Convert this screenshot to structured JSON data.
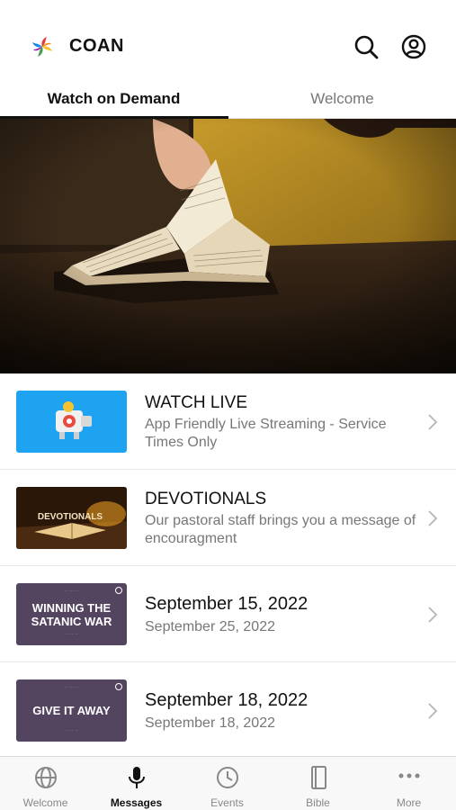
{
  "header": {
    "app_name": "COAN",
    "logo_icon": "colorful-pinwheel-logo",
    "search_icon": "search-icon",
    "account_icon": "user-circle-icon"
  },
  "tabs": [
    {
      "label": "Watch on Demand",
      "active": true
    },
    {
      "label": "Welcome",
      "active": false
    }
  ],
  "hero": {
    "description_icon": "open-bible-photo"
  },
  "list": [
    {
      "title": "WATCH LIVE",
      "subtitle": "App Friendly Live Streaming - Service Times Only",
      "thumb": "live-stream-camera"
    },
    {
      "title": "DEVOTIONALS",
      "subtitle": "Our pastoral staff brings you a message of encouragment",
      "thumb": "devotionals-bible",
      "thumb_text": "DEVOTIONALS"
    },
    {
      "title": "September 15, 2022",
      "subtitle": "September 25, 2022",
      "thumb": "sermon-card",
      "thumb_text": "WINNING THE SATANIC WAR"
    },
    {
      "title": "September 18, 2022",
      "subtitle": "September 18, 2022",
      "thumb": "sermon-card",
      "thumb_text": "GIVE IT AWAY"
    }
  ],
  "tabbar": [
    {
      "label": "Welcome",
      "icon": "globe-icon",
      "active": false
    },
    {
      "label": "Messages",
      "icon": "microphone-icon",
      "active": true
    },
    {
      "label": "Events",
      "icon": "clock-icon",
      "active": false
    },
    {
      "label": "Bible",
      "icon": "book-icon",
      "active": false
    },
    {
      "label": "More",
      "icon": "more-dots-icon",
      "active": false
    }
  ],
  "colors": {
    "accent": "#111111",
    "inactive": "#888888",
    "live_thumb": "#1ea3f0",
    "sermon_thumb": "#53445f"
  }
}
